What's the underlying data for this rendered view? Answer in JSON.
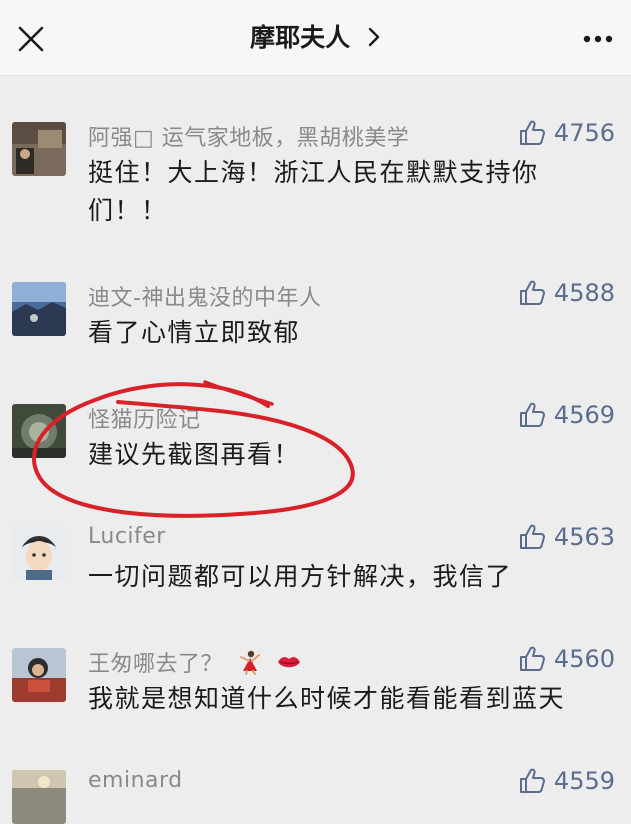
{
  "header": {
    "title": "摩耶夫人",
    "close_icon": "close-icon",
    "chevron_icon": "chevron-right-icon",
    "more_icon": "more-dots-icon"
  },
  "comments": [
    {
      "nickname": "阿强□ 运气家地板，黑胡桃美学",
      "likes": "4756",
      "text": "挺住！大上海！浙江人民在默默支持你们！！"
    },
    {
      "nickname": "迪文-神出鬼没的中年人",
      "likes": "4588",
      "text": "看了心情立即致郁"
    },
    {
      "nickname": "怪猫历险记",
      "likes": "4569",
      "text": "建议先截图再看！"
    },
    {
      "nickname": "Lucifer",
      "likes": "4563",
      "text": "一切问题都可以用方针解决，我信了"
    },
    {
      "nickname": "王匆哪去了？",
      "likes": "4560",
      "text": "我就是想知道什么时候才能看能看到蓝天"
    },
    {
      "nickname": "eminard",
      "likes": "4559",
      "text": ""
    }
  ],
  "icons": {
    "like": "thumbs-up-icon",
    "nickname_emoji_1": "dancer-emoji-icon",
    "nickname_emoji_2": "lips-emoji-icon"
  },
  "colors": {
    "background": "#ededed",
    "header_bg": "#f7f7f7",
    "nickname": "#8a8a8a",
    "like": "#5b6d8f",
    "content": "#1b1b1b",
    "annotation_circle": "#d8222a"
  }
}
